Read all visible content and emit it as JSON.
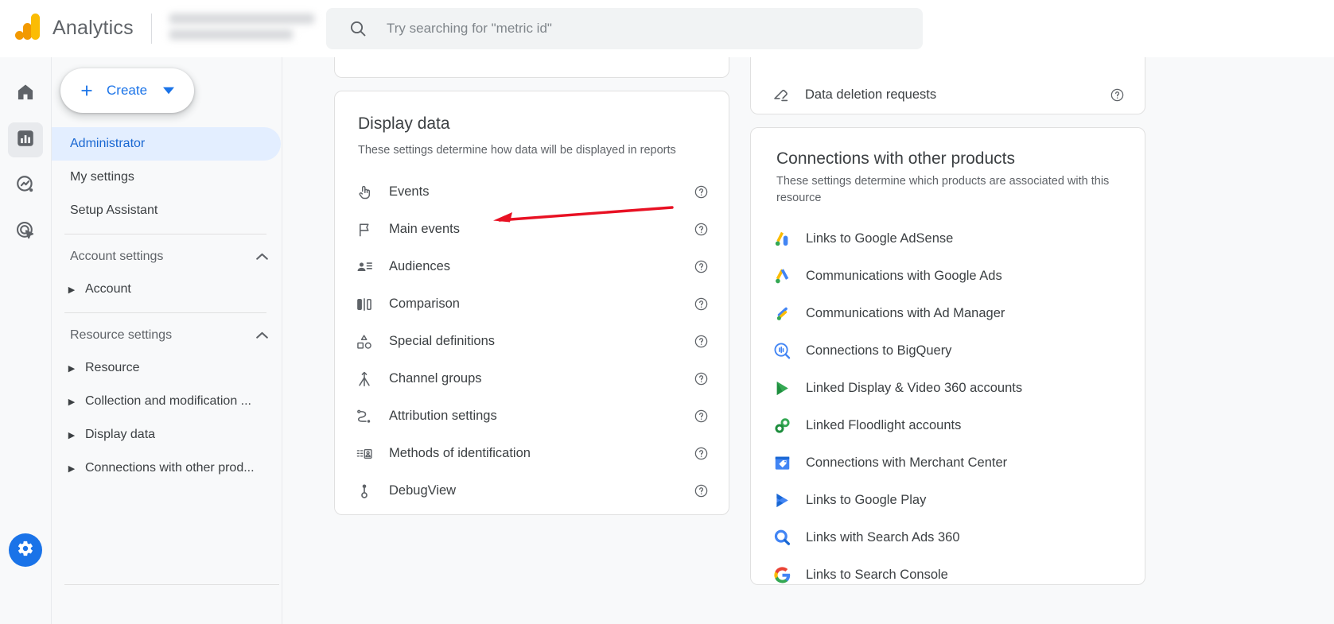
{
  "header": {
    "brand": "Analytics",
    "logo_icon": "analytics-logo-icon",
    "account_name_redacted": "",
    "search": {
      "icon": "search-icon",
      "placeholder": "Try searching for \"metric id\"",
      "value": ""
    }
  },
  "rail": {
    "items": [
      {
        "name": "home",
        "icon": "home-icon",
        "active": false
      },
      {
        "name": "reports",
        "icon": "bar-chart-icon",
        "active": true
      },
      {
        "name": "explore",
        "icon": "explore-trend-icon",
        "active": false
      },
      {
        "name": "advertising",
        "icon": "advertising-target-icon",
        "active": false
      }
    ],
    "gear_icon": "gear-icon"
  },
  "nav": {
    "create_button": {
      "label": "Create",
      "plus_icon": "plus-icon",
      "caret_icon": "chevron-down-icon"
    },
    "items": [
      {
        "label": "Administrator",
        "selected": true
      },
      {
        "label": "My settings",
        "selected": false
      },
      {
        "label": "Setup Assistant",
        "selected": false
      }
    ],
    "groups": [
      {
        "title": "Account settings",
        "chevron_icon": "chevron-up-icon",
        "children": [
          {
            "label": "Account"
          }
        ]
      },
      {
        "title": "Resource settings",
        "chevron_icon": "chevron-up-icon",
        "children": [
          {
            "label": "Resource"
          },
          {
            "label": "Collection and modification ..."
          },
          {
            "label": "Display data"
          },
          {
            "label": "Connections with other prod..."
          }
        ]
      }
    ],
    "collapse_icon": "chevron-left-icon"
  },
  "display_data_card": {
    "title": "Display data",
    "subtitle": "These settings determine how data will be displayed in reports",
    "help_icon": "help-circle-icon",
    "rows": [
      {
        "label": "Events",
        "icon": "tap-gesture-icon"
      },
      {
        "label": "Main events",
        "icon": "flag-icon"
      },
      {
        "label": "Audiences",
        "icon": "audience-person-list-icon"
      },
      {
        "label": "Comparison",
        "icon": "comparison-bars-icon"
      },
      {
        "label": "Special definitions",
        "icon": "shapes-icon"
      },
      {
        "label": "Channel groups",
        "icon": "channel-merge-icon"
      },
      {
        "label": "Attribution settings",
        "icon": "attribution-path-icon"
      },
      {
        "label": "Methods of identification",
        "icon": "identification-card-icon"
      },
      {
        "label": "DebugView",
        "icon": "debug-bug-icon"
      }
    ]
  },
  "data_retention_card": {
    "rows": [
      {
        "label": "Data deletion requests",
        "icon": "eraser-icon"
      }
    ],
    "help_icon": "help-circle-icon"
  },
  "connections_card": {
    "title": "Connections with other products",
    "subtitle": "These settings determine which products are associated with this resource",
    "rows": [
      {
        "label": "Links to Google AdSense",
        "icon": "google-adsense-icon"
      },
      {
        "label": "Communications with Google Ads",
        "icon": "google-ads-icon"
      },
      {
        "label": "Communications with Ad Manager",
        "icon": "ad-manager-icon"
      },
      {
        "label": "Connections to BigQuery",
        "icon": "bigquery-icon"
      },
      {
        "label": "Linked Display & Video 360 accounts",
        "icon": "display-video-360-icon"
      },
      {
        "label": "Linked Floodlight accounts",
        "icon": "floodlight-icon"
      },
      {
        "label": "Connections with Merchant Center",
        "icon": "merchant-center-icon"
      },
      {
        "label": "Links to Google Play",
        "icon": "google-play-icon"
      },
      {
        "label": "Links with Search Ads 360",
        "icon": "search-ads-360-icon"
      },
      {
        "label": "Links to Search Console",
        "icon": "search-console-icon"
      }
    ]
  },
  "annotation": {
    "type": "arrow",
    "color": "#e81123",
    "points_to": "Main events"
  },
  "colors": {
    "accent_blue": "#1a73e8",
    "selected_bg": "#e3eeff",
    "text_primary": "#3c4043",
    "text_secondary": "#5f6368",
    "page_bg": "#f8f9fa",
    "annotation_red": "#e81123"
  }
}
